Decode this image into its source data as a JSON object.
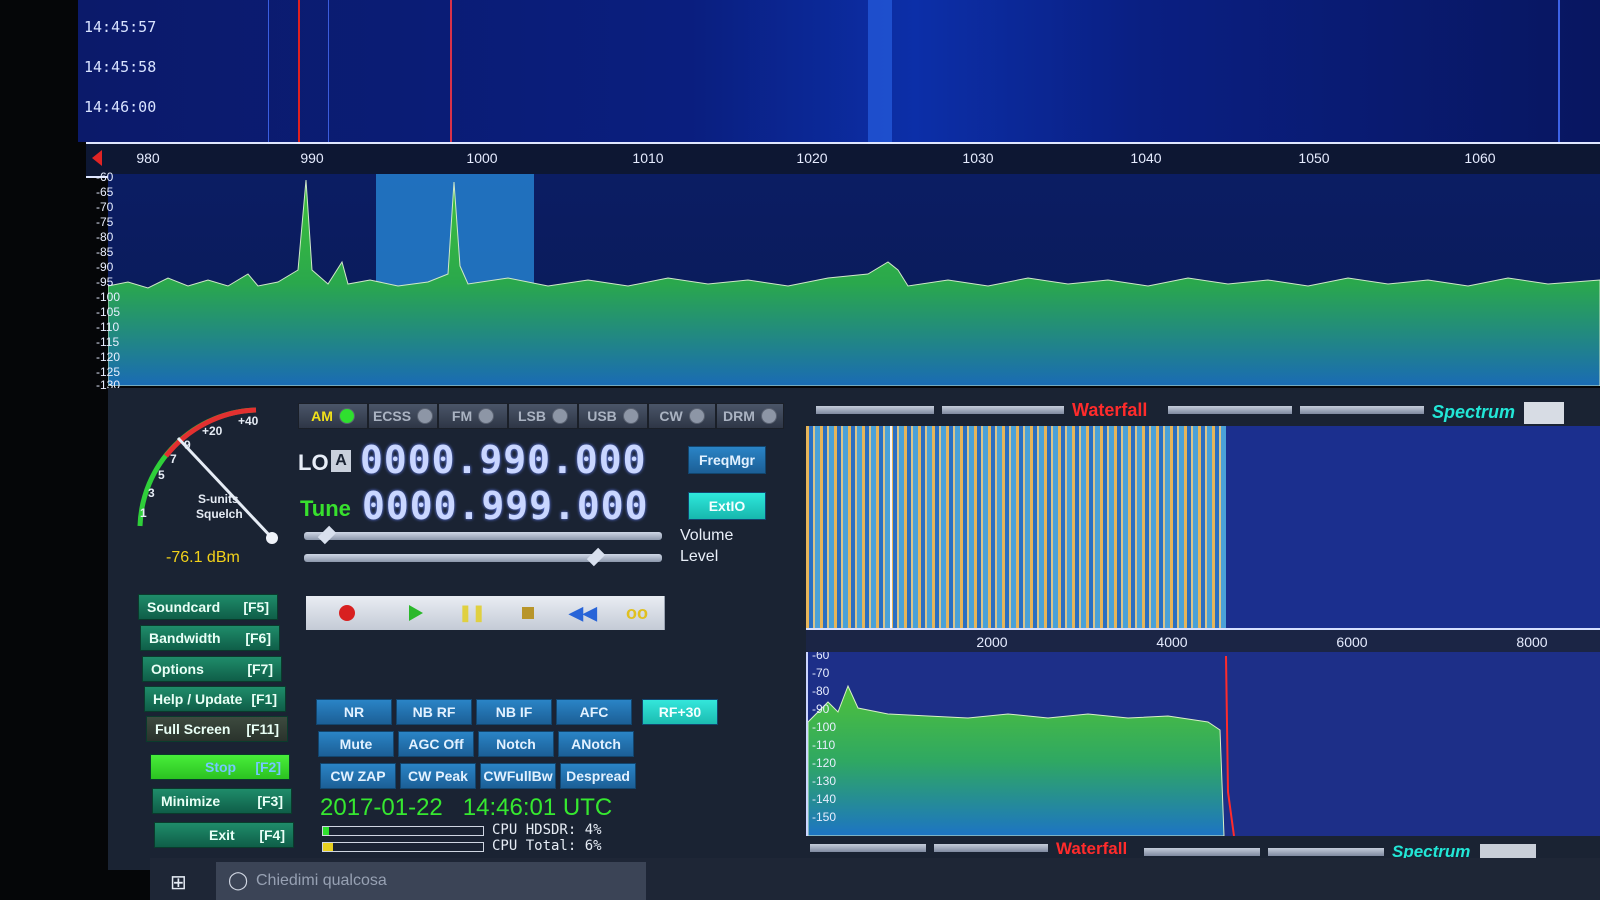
{
  "waterfall_top": {
    "timestamps": [
      "14:45:57",
      "14:45:58",
      "14:46:00"
    ]
  },
  "freq_axis": {
    "ticks": [
      "980",
      "990",
      "1000",
      "1010",
      "1020",
      "1030",
      "1040",
      "1050",
      "1060"
    ]
  },
  "spectrum": {
    "db_labels": [
      "-60",
      "-65",
      "-70",
      "-75",
      "-80",
      "-85",
      "-90",
      "-95",
      "-100",
      "-105",
      "-110",
      "-115",
      "-120",
      "-125",
      "-130"
    ]
  },
  "smeter": {
    "scale": [
      "1",
      "3",
      "5",
      "7",
      "9",
      "+20",
      "+40"
    ],
    "label_line1": "S-units",
    "label_line2": "Squelch",
    "reading": "-76.1 dBm"
  },
  "modes": [
    {
      "label": "AM",
      "active": true
    },
    {
      "label": "ECSS",
      "active": false
    },
    {
      "label": "FM",
      "active": false
    },
    {
      "label": "LSB",
      "active": false
    },
    {
      "label": "USB",
      "active": false
    },
    {
      "label": "CW",
      "active": false
    },
    {
      "label": "DRM",
      "active": false
    }
  ],
  "lo": {
    "label": "LO",
    "badge": "A",
    "value": "0000.990.000"
  },
  "tune": {
    "label": "Tune",
    "value": "0000.999.000"
  },
  "freqmgr_label": "FreqMgr",
  "extio_label": "ExtIO",
  "volume_label": "Volume",
  "level_label": "Level",
  "volume_level": 0.05,
  "level_level": 0.82,
  "menu": [
    {
      "label": "Soundcard",
      "key": "[F5]"
    },
    {
      "label": "Bandwidth",
      "key": "[F6]"
    },
    {
      "label": "Options",
      "key": "[F7]"
    },
    {
      "label": "Help / Update",
      "key": "[F1]"
    },
    {
      "label": "Full Screen",
      "key": "[F11]"
    },
    {
      "label": "Stop",
      "key": "[F2]"
    },
    {
      "label": "Minimize",
      "key": "[F3]"
    },
    {
      "label": "Exit",
      "key": "[F4]"
    }
  ],
  "dsp_buttons": {
    "row1": [
      "NR",
      "NB RF",
      "NB IF",
      "AFC"
    ],
    "row2": [
      "Mute",
      "AGC Off",
      "Notch",
      "ANotch"
    ],
    "row3": [
      "CW ZAP",
      "CW Peak",
      "CWFullBw",
      "Despread"
    ],
    "rf_label": "RF+30"
  },
  "transport_icons": [
    "record-icon",
    "play-icon",
    "pause-icon",
    "stop-icon",
    "rewind-icon",
    "loop-icon"
  ],
  "datetime": "2017-01-22   14:46:01 UTC",
  "cpu": {
    "line1": "CPU HDSDR: 4%",
    "line2": "CPU Total: 6%"
  },
  "af_panel": {
    "waterfall_label": "Waterfall",
    "spectrum_label": "Spectrum",
    "axis_ticks": [
      "2000",
      "4000",
      "6000",
      "8000"
    ],
    "db_labels": [
      "-60",
      "-70",
      "-80",
      "-90",
      "-100",
      "-110",
      "-120",
      "-130",
      "-140",
      "-150"
    ]
  },
  "taskbar": {
    "search_placeholder": "Chiedimi qualcosa"
  },
  "colors": {
    "accent_green": "#2fe02f",
    "waterfall_red": "#ff2b2b",
    "spectrum_cyan": "#22e6d6"
  }
}
